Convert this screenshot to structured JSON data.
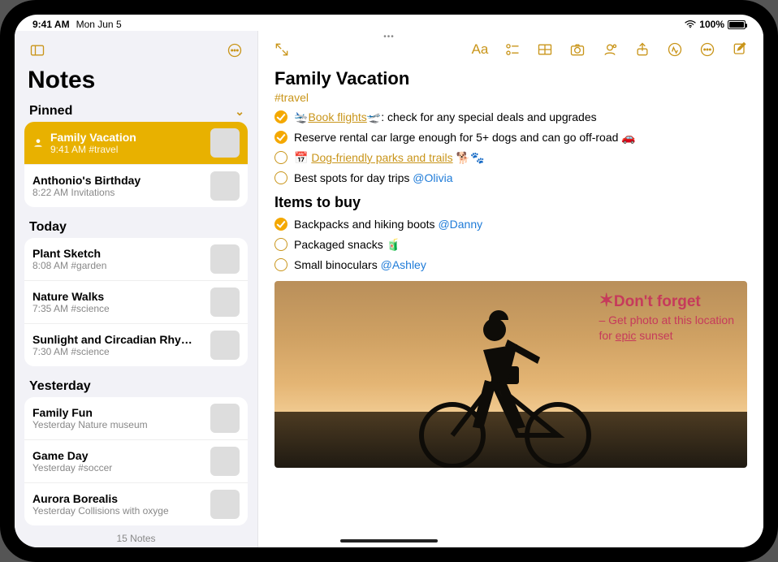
{
  "status": {
    "time": "9:41 AM",
    "date": "Mon Jun 5",
    "battery": "100%"
  },
  "sidebar": {
    "title": "Notes",
    "pinned_label": "Pinned",
    "today_label": "Today",
    "yesterday_label": "Yesterday",
    "footer": "15 Notes",
    "pinned": [
      {
        "title": "Family Vacation",
        "sub": "9:41 AM  #travel",
        "selected": true
      },
      {
        "title": "Anthonio's Birthday",
        "sub": "8:22 AM  Invitations"
      }
    ],
    "today": [
      {
        "title": "Plant Sketch",
        "sub": "8:08 AM  #garden"
      },
      {
        "title": "Nature Walks",
        "sub": "7:35 AM  #science"
      },
      {
        "title": "Sunlight and Circadian Rhy…",
        "sub": "7:30 AM  #science"
      }
    ],
    "yesterday": [
      {
        "title": "Family Fun",
        "sub": "Yesterday  Nature museum"
      },
      {
        "title": "Game Day",
        "sub": "Yesterday  #soccer"
      },
      {
        "title": "Aurora Borealis",
        "sub": "Yesterday  Collisions with oxyge"
      }
    ]
  },
  "note": {
    "title": "Family Vacation",
    "tag": "#travel",
    "todo": [
      {
        "done": true,
        "pre": "🛬",
        "link": "Book flights",
        "post": "🛫: check for any special deals and upgrades"
      },
      {
        "done": true,
        "text": "Reserve rental car large enough for 5+ dogs and can go off-road 🚗"
      },
      {
        "done": false,
        "pre": "📅 ",
        "link": "Dog-friendly parks and trails",
        "post": " 🐕🐾"
      },
      {
        "done": false,
        "text": "Best spots for day trips ",
        "mention": "@Olivia"
      }
    ],
    "buy_header": "Items to buy",
    "buy": [
      {
        "done": true,
        "text": "Backpacks and hiking boots ",
        "mention": "@Danny"
      },
      {
        "done": false,
        "text": "Packaged snacks 🧃"
      },
      {
        "done": false,
        "text": "Small binoculars ",
        "mention": "@Ashley"
      }
    ],
    "handwriting": {
      "line1": "Don't forget",
      "line2": "– Get photo at this location",
      "line3": "for ",
      "line3_u": "epic",
      "line3_end": " sunset"
    }
  }
}
